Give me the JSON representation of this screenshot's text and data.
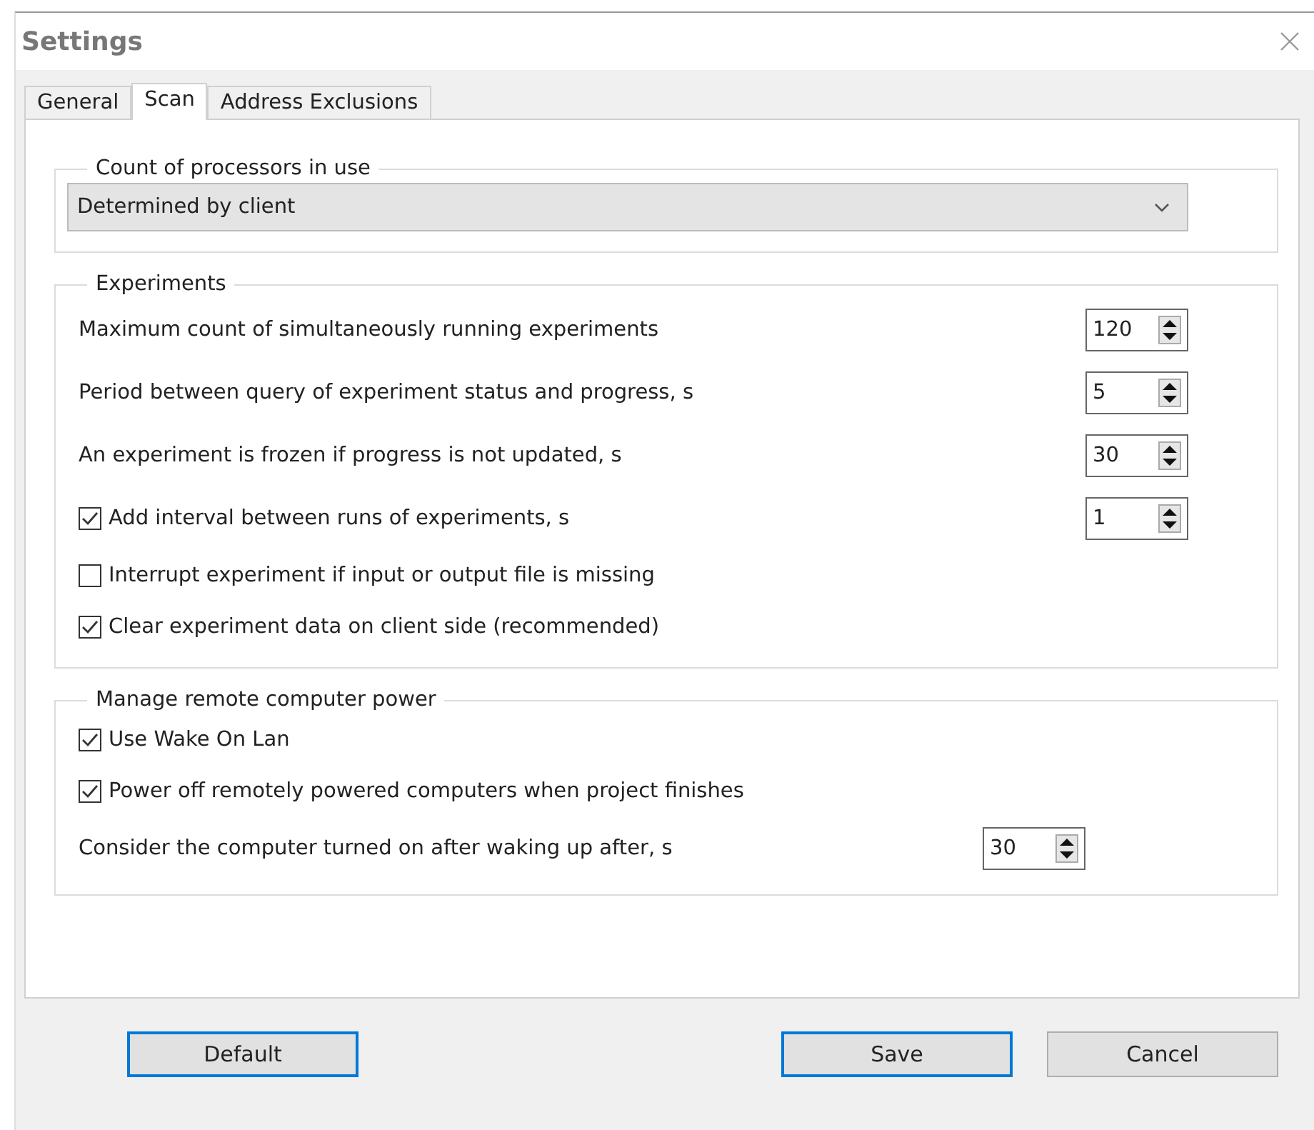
{
  "window": {
    "title": "Settings"
  },
  "tabs": [
    {
      "label": "General",
      "selected": false
    },
    {
      "label": "Scan",
      "selected": true
    },
    {
      "label": "Address Exclusions",
      "selected": false
    }
  ],
  "groups": [
    {
      "title": "Count of processors in use",
      "rows": [
        {
          "kind": "dropdown",
          "value": "Determined by client"
        }
      ]
    },
    {
      "title": "Experiments",
      "rows": [
        {
          "kind": "number",
          "label": "Maximum count of simultaneously running experiments",
          "value": "120"
        },
        {
          "kind": "number",
          "label": "Period between query of experiment status and progress, s",
          "value": "5"
        },
        {
          "kind": "number",
          "label": "An experiment is frozen if progress is not updated, s",
          "value": "30"
        },
        {
          "kind": "check_number",
          "label": "Add interval between runs of experiments, s",
          "checked": true,
          "value": "1"
        },
        {
          "kind": "check",
          "label": "Interrupt experiment if input or output file is missing",
          "checked": false
        },
        {
          "kind": "check",
          "label": "Clear experiment data on client side (recommended)",
          "checked": true
        }
      ]
    },
    {
      "title": "Manage remote computer power",
      "rows": [
        {
          "kind": "check",
          "label": "Use Wake On Lan",
          "checked": true
        },
        {
          "kind": "check",
          "label": "Power off remotely powered computers when project finishes",
          "checked": true
        },
        {
          "kind": "number",
          "label": "Consider the computer turned on after waking up after, s",
          "value": "30"
        }
      ]
    }
  ],
  "buttons": [
    {
      "label": "Default",
      "highlighted": true
    },
    {
      "label": "Save",
      "highlighted": true
    },
    {
      "label": "Cancel",
      "highlighted": false
    }
  ]
}
